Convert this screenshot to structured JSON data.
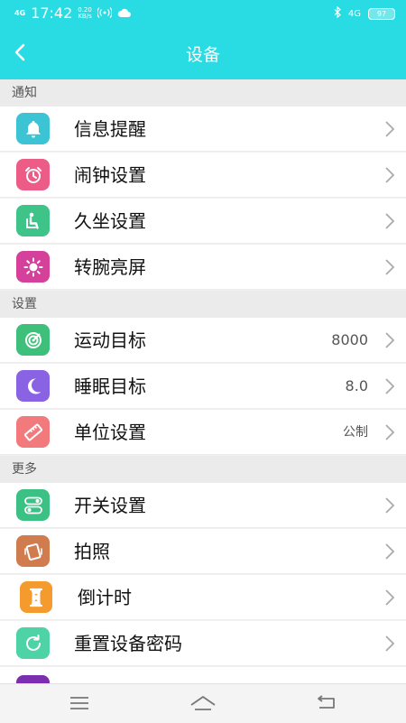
{
  "status_bar": {
    "network": "4G",
    "time": "17:42",
    "speed_value": "0.20",
    "speed_unit": "KB/s",
    "signal_right": "4G",
    "battery": "97"
  },
  "header": {
    "title": "设备"
  },
  "sections": {
    "notify": "通知",
    "settings": "设置",
    "more": "更多"
  },
  "items": {
    "message_reminder": {
      "label": "信息提醒",
      "color": "#3cc4d4",
      "icon": "bell-icon"
    },
    "alarm": {
      "label": "闹钟设置",
      "color": "#ec5c87",
      "icon": "alarm-clock-icon"
    },
    "sedentary": {
      "label": "久坐设置",
      "color": "#3ec488",
      "icon": "sitting-person-icon"
    },
    "wrist_screen": {
      "label": "转腕亮屏",
      "color": "#d5409b",
      "icon": "sun-icon"
    },
    "step_goal": {
      "label": "运动目标",
      "value": "8000",
      "color": "#3ec07a",
      "icon": "target-icon"
    },
    "sleep_goal": {
      "label": "睡眠目标",
      "value": "8.0",
      "color": "#8a63e4",
      "icon": "moon-icon"
    },
    "units": {
      "label": "单位设置",
      "value": "公制",
      "color": "#f2797c",
      "icon": "ruler-icon"
    },
    "switches": {
      "label": "开关设置",
      "color": "#3cc184",
      "icon": "toggle-icon"
    },
    "camera": {
      "label": "拍照",
      "color": "#d07c4f",
      "icon": "camera-shake-icon"
    },
    "countdown": {
      "label": "倒计时",
      "color": "#f59a2c",
      "icon": "hourglass-icon"
    },
    "reset_password": {
      "label": "重置设备密码",
      "color": "#4dd3a6",
      "icon": "refresh-icon"
    }
  },
  "partial_item": {
    "color": "#7b2fb0"
  }
}
